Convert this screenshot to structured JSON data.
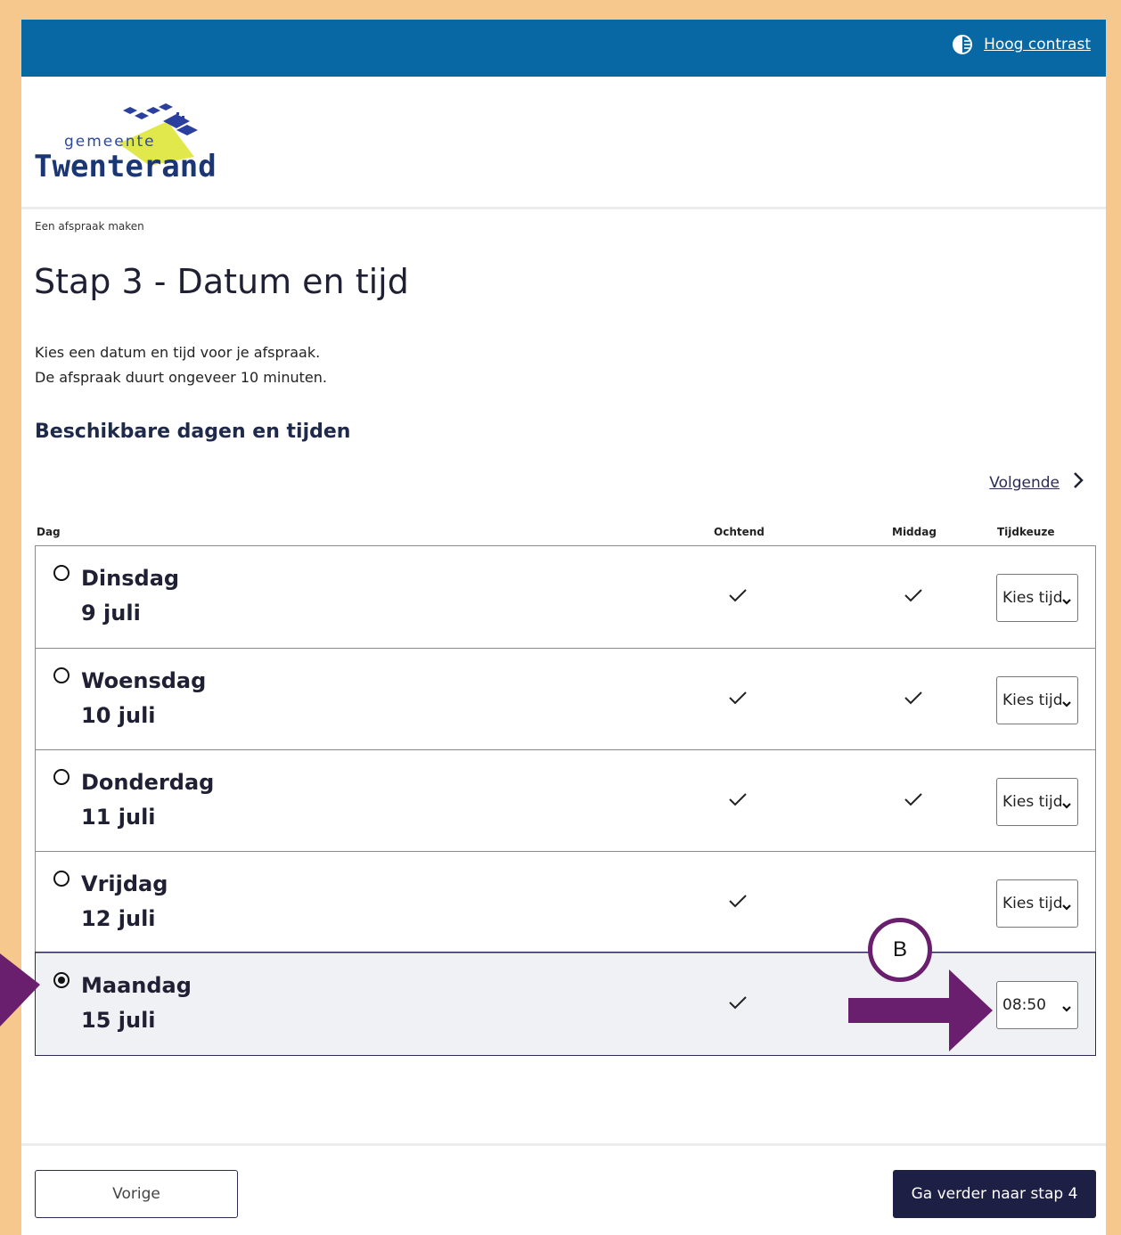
{
  "topbar": {
    "contrast_label": "Hoog contrast",
    "contrast_icon": "contrast-icon"
  },
  "logo": {
    "line1": "gemeente",
    "line2": "Twenterand"
  },
  "breadcrumb": "Een afspraak maken",
  "title": "Stap 3 - Datum en tijd",
  "intro": {
    "line1": "Kies een datum en tijd voor je afspraak.",
    "line2": "De afspraak duurt ongeveer 10 minuten."
  },
  "subtitle": "Beschikbare dagen en tijden",
  "next_link": "Volgende",
  "table": {
    "headers": {
      "day": "Dag",
      "morning": "Ochtend",
      "afternoon": "Middag",
      "time": "Tijdkeuze"
    },
    "rows": [
      {
        "day": "Dinsdag",
        "date": "9 juli",
        "morning": true,
        "afternoon": true,
        "time": "Kies tijd",
        "selected": false
      },
      {
        "day": "Woensdag",
        "date": "10 juli",
        "morning": true,
        "afternoon": true,
        "time": "Kies tijd",
        "selected": false
      },
      {
        "day": "Donderdag",
        "date": "11 juli",
        "morning": true,
        "afternoon": true,
        "time": "Kies tijd",
        "selected": false
      },
      {
        "day": "Vrijdag",
        "date": "12 juli",
        "morning": true,
        "afternoon": false,
        "time": "Kies tijd",
        "selected": false
      },
      {
        "day": "Maandag",
        "date": "15 juli",
        "morning": true,
        "afternoon": false,
        "time": "08:50",
        "selected": true
      }
    ]
  },
  "annotation": {
    "marker_label": "B",
    "color": "#6a1f6e"
  },
  "buttons": {
    "previous": "Vorige",
    "next": "Ga verder naar stap 4"
  },
  "colors": {
    "topbar": "#0868a3",
    "frame": "#f6c88e",
    "primary_button": "#1e1f45"
  }
}
